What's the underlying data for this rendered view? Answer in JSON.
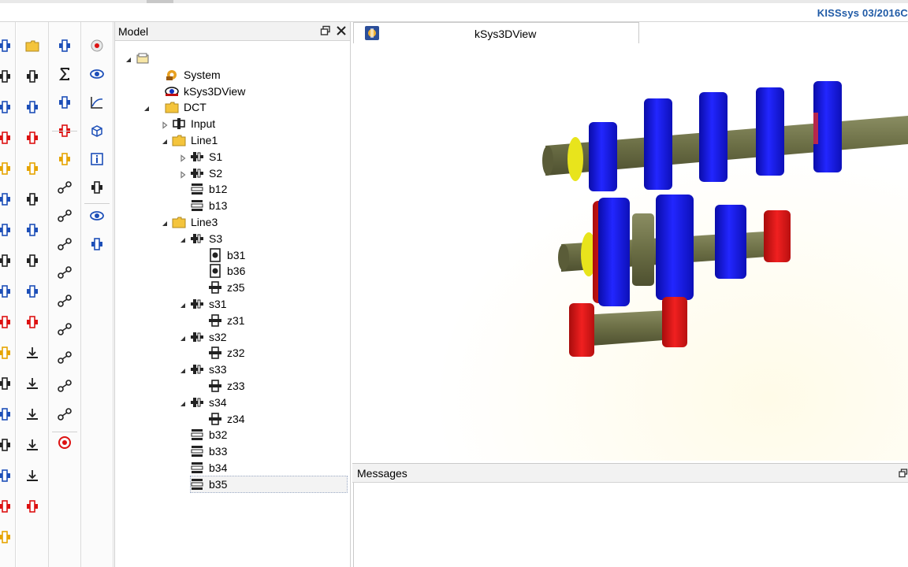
{
  "app": {
    "brand": "KISSsys 03/2016C"
  },
  "colors": {
    "gear_blue": "#1a1ee0",
    "shaft_olive": "#6e7248",
    "bearing_red": "#e01818",
    "bearing_yellow": "#e8e41c",
    "folder_yellow": "#f4c43c",
    "accent_blue": "#1f5aa6"
  },
  "model_panel": {
    "title": "Model",
    "float_icon": "float-window-icon",
    "close_icon": "close-icon",
    "tree": [
      {
        "label": "",
        "depth": 0,
        "icon": "root-folder-icon",
        "expander": "expanded"
      },
      {
        "label": "System",
        "depth": 1,
        "icon": "system-icon",
        "expander": "none"
      },
      {
        "label": "kSys3DView",
        "depth": 1,
        "icon": "eye-3d-icon",
        "expander": "none"
      },
      {
        "label": "DCT",
        "depth": 1,
        "icon": "folder-icon",
        "expander": "expanded"
      },
      {
        "label": "Input",
        "depth": 2,
        "icon": "coupling-icon",
        "expander": "collapsed"
      },
      {
        "label": "Line1",
        "depth": 2,
        "icon": "folder-icon",
        "expander": "expanded"
      },
      {
        "label": "S1",
        "depth": 3,
        "icon": "shaft-icon",
        "expander": "collapsed"
      },
      {
        "label": "S2",
        "depth": 3,
        "icon": "shaft-icon",
        "expander": "collapsed"
      },
      {
        "label": "b12",
        "depth": 3,
        "icon": "bearing-icon",
        "expander": "none"
      },
      {
        "label": "b13",
        "depth": 3,
        "icon": "bearing-icon",
        "expander": "none"
      },
      {
        "label": "Line3",
        "depth": 2,
        "icon": "folder-icon",
        "expander": "expanded"
      },
      {
        "label": "S3",
        "depth": 3,
        "icon": "shaft-icon",
        "expander": "expanded"
      },
      {
        "label": "b31",
        "depth": 4,
        "icon": "roller-bearing-icon",
        "expander": "none"
      },
      {
        "label": "b36",
        "depth": 4,
        "icon": "roller-bearing-icon",
        "expander": "none"
      },
      {
        "label": "z35",
        "depth": 4,
        "icon": "gear-icon",
        "expander": "none"
      },
      {
        "label": "s31",
        "depth": 3,
        "icon": "shaft-icon",
        "expander": "expanded"
      },
      {
        "label": "z31",
        "depth": 4,
        "icon": "gear-icon",
        "expander": "none"
      },
      {
        "label": "s32",
        "depth": 3,
        "icon": "shaft-icon",
        "expander": "expanded"
      },
      {
        "label": "z32",
        "depth": 4,
        "icon": "gear-icon",
        "expander": "none"
      },
      {
        "label": "s33",
        "depth": 3,
        "icon": "shaft-icon",
        "expander": "expanded"
      },
      {
        "label": "z33",
        "depth": 4,
        "icon": "gear-icon",
        "expander": "none"
      },
      {
        "label": "s34",
        "depth": 3,
        "icon": "shaft-icon",
        "expander": "expanded"
      },
      {
        "label": "z34",
        "depth": 4,
        "icon": "gear-icon",
        "expander": "none"
      },
      {
        "label": "b32",
        "depth": 3,
        "icon": "bearing-icon",
        "expander": "none"
      },
      {
        "label": "b33",
        "depth": 3,
        "icon": "bearing-icon",
        "expander": "none"
      },
      {
        "label": "b34",
        "depth": 3,
        "icon": "bearing-icon",
        "expander": "none"
      },
      {
        "label": "b35",
        "depth": 3,
        "icon": "bearing-icon",
        "expander": "none",
        "selected": true
      }
    ]
  },
  "view_tab": {
    "label": "kSys3DView",
    "icon": "view-3d-tab-icon"
  },
  "messages_panel": {
    "title": "Messages",
    "float_icon": "float-window-icon"
  },
  "toolbars": {
    "col1": [
      "shaft-tool-icon",
      "coupling-tool-icon",
      "shaft-end-tool-icon",
      "gear-pair-tool-icon",
      "bearing-tool-icon",
      "link-tool-icon",
      "sensor-tool-icon",
      "motor-tool-icon",
      "clutch-tool-icon",
      "brake-tool-icon",
      "rotate-tool-icon",
      "spring-tool-icon",
      "pump-tool-icon",
      "support-tool-icon",
      "actuator-tool-icon",
      "flow-tool-icon",
      "marker-tool-icon"
    ],
    "col2": [
      "folder-tool-icon",
      "block-tool-icon",
      "cylinder-tool-icon",
      "cap-tool-icon",
      "wedge-tool-icon",
      "element-tool-icon",
      "arrow-right-tool-icon",
      "bracket-tool-icon",
      "spring-element-icon",
      "damper-tool-icon",
      "download-tool-icon",
      "load-tool-icon",
      "load-down-tool-icon",
      "load-base-tool-icon",
      "upload-tool-icon",
      "column-tool-icon"
    ],
    "col3": [
      "connect-tool-icon",
      "sigma-icon",
      "stack-tool-icon",
      "edit-tool-icon",
      "property-tool-icon",
      "branch-tool-icon",
      "branch2-tool-icon",
      "branch3-tool-icon",
      "branch4-tool-icon",
      "branch5-tool-icon",
      "branch6-tool-icon",
      "branch7-tool-icon",
      "branch8-tool-icon",
      "branch9-tool-icon",
      "target-tool-icon"
    ],
    "col4": [
      "ball-icon",
      "eye-icon",
      "graph-icon",
      "cube-icon",
      "info-icon",
      "copy-icon",
      "eye-blue-icon",
      "link-blue-icon"
    ]
  }
}
